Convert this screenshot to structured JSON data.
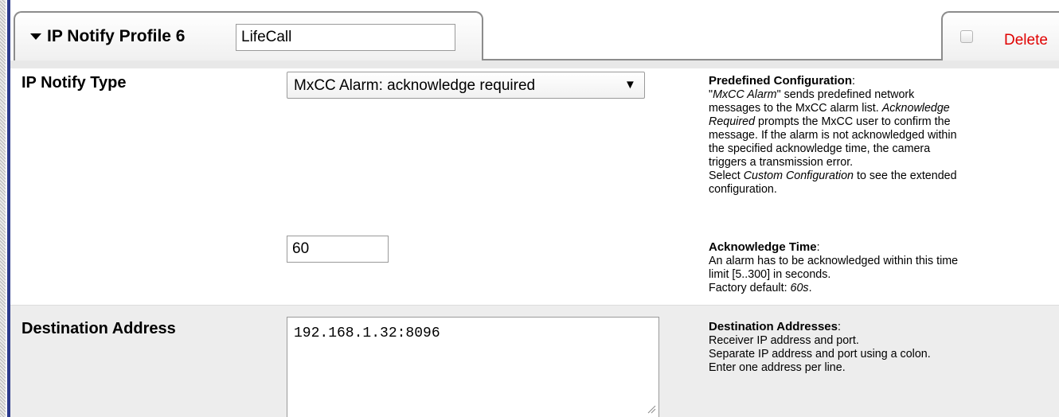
{
  "header": {
    "profile_title": "IP Notify Profile 6",
    "profile_name": "LifeCall",
    "delete_label": "Delete",
    "delete_checked": false
  },
  "fields": {
    "ip_notify_type": {
      "label": "IP Notify Type",
      "selected_value": "MxCC Alarm: acknowledge required"
    },
    "acknowledge_time": {
      "value": "60"
    },
    "destination_address": {
      "label": "Destination Address",
      "value": "192.168.1.32:8096"
    }
  },
  "help": {
    "predefined": {
      "title": "Predefined Configuration",
      "colon": ":",
      "l1_q_open": "\"",
      "l1_italic": "MxCC Alarm",
      "l1_q_close": "\"",
      "l1_rest": " sends predefined network",
      "l2": "messages to the MxCC alarm list. ",
      "l2_italic": "Acknowledge",
      "l3_italic": "Required",
      "l3_rest": " prompts the MxCC user to confirm the",
      "l4": "message. If the alarm is not acknowledged within",
      "l5": "the specified acknowledge time, the camera",
      "l6": "triggers a transmission error.",
      "l7_pre": "Select ",
      "l7_italic": "Custom Configuration",
      "l7_rest": " to see the extended",
      "l8": "configuration."
    },
    "ack_time": {
      "title": "Acknowledge Time",
      "colon": ":",
      "l1": "An alarm has to be acknowledged within this time",
      "l2": "limit [5..300] in seconds.",
      "l3_pre": "Factory default: ",
      "l3_italic": "60s",
      "l3_post": "."
    },
    "destination": {
      "title": "Destination Addresses",
      "colon": ":",
      "l1": "Receiver IP address and port.",
      "l2": "Separate IP address and port using a colon.",
      "l3": "Enter one address per line."
    }
  }
}
